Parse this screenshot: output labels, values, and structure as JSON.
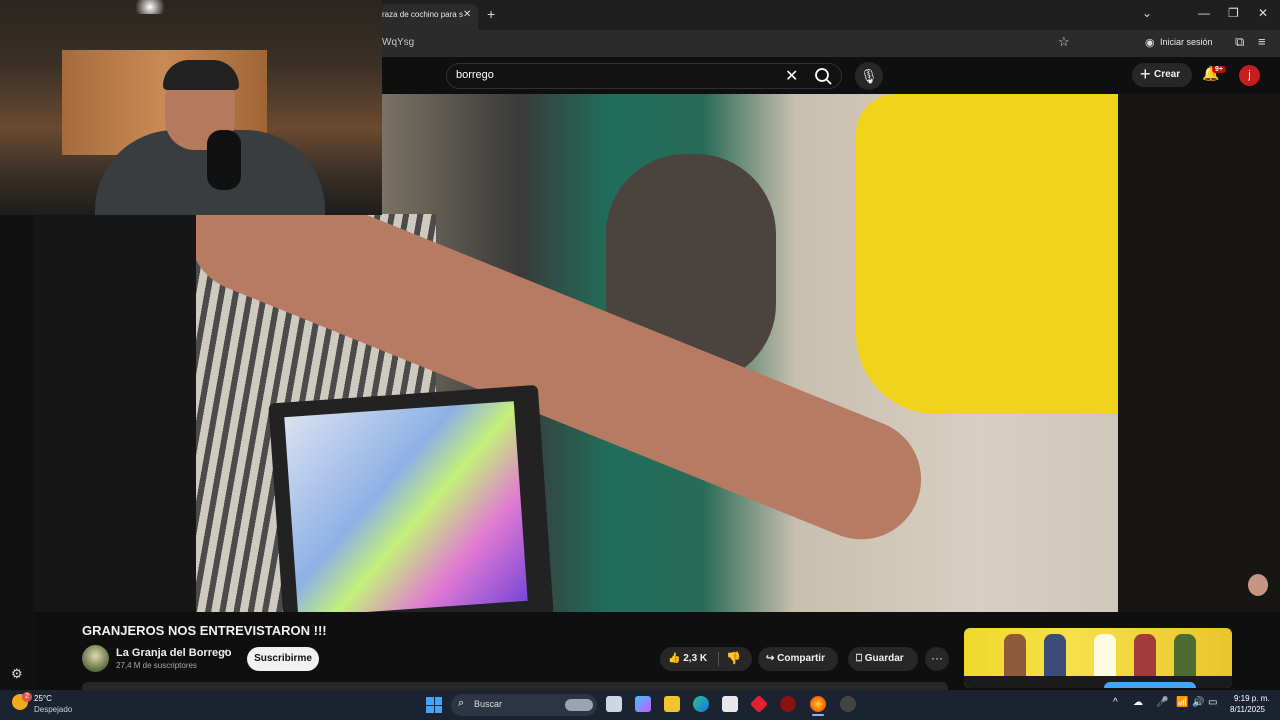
{
  "browser": {
    "tab_title": "raza de cochino para s",
    "tab_close": "✕",
    "new_tab": "+",
    "url": "WqYsg",
    "signin": "Iniciar sesión",
    "window_min": "—",
    "window_max": "❐",
    "window_close": "✕",
    "tab_list": "⌄"
  },
  "youtube": {
    "search_value": "borrego",
    "create_label": "Crear",
    "notification_count": "9+",
    "avatar_letter": "j"
  },
  "video": {
    "title": "GRANJEROS NOS ENTREVISTARON !!!",
    "channel_name": "La Granja del Borrego",
    "channel_subs": "27,4 M de suscriptores",
    "subscribe_label": "Suscribirme",
    "like_count": "2,3 K",
    "share_label": "Compartir",
    "save_label": "Guardar",
    "more_label": "···"
  },
  "taskbar": {
    "temperature": "25°C",
    "weather": "Despejado",
    "weather_badge": "2",
    "search_placeholder": "Buscar",
    "time": "9:19 p. m.",
    "date": "8/11/2025"
  },
  "colors": {
    "accent_red": "#cc0000",
    "background": "#0f0f0f",
    "taskbar": "#1c2330"
  }
}
